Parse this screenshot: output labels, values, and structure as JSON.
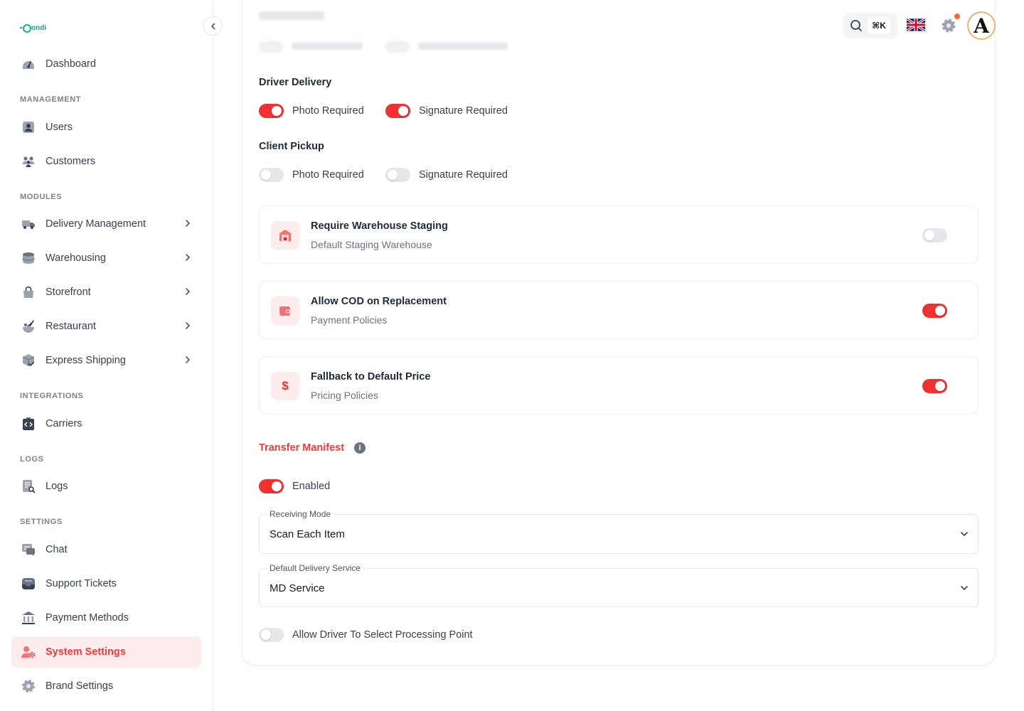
{
  "brand": {
    "name": "ondi"
  },
  "sidebar": {
    "dashboard": "Dashboard",
    "sections": {
      "management": "MANAGEMENT",
      "modules": "MODULES",
      "integrations": "INTEGRATIONS",
      "logs": "LOGS",
      "settings": "SETTINGS"
    },
    "items": {
      "users": "Users",
      "customers": "Customers",
      "delivery_management": "Delivery Management",
      "warehousing": "Warehousing",
      "storefront": "Storefront",
      "restaurant": "Restaurant",
      "express_shipping": "Express Shipping",
      "carriers": "Carriers",
      "logs": "Logs",
      "chat": "Chat",
      "support_tickets": "Support Tickets",
      "payment_methods": "Payment Methods",
      "system_settings": "System Settings",
      "brand_settings": "Brand Settings"
    },
    "active": "system_settings"
  },
  "topbar": {
    "search_shortcut": "⌘K",
    "language_icon": "uk-flag-icon",
    "settings_icon": "gear-icon",
    "has_notification": true
  },
  "settings": {
    "driver_delivery": {
      "title": "Driver Delivery",
      "photo_label": "Photo Required",
      "photo_on": true,
      "signature_label": "Signature Required",
      "signature_on": true
    },
    "client_pickup": {
      "title": "Client Pickup",
      "photo_label": "Photo Required",
      "photo_on": false,
      "signature_label": "Signature Required",
      "signature_on": false
    },
    "policies": [
      {
        "title": "Require Warehouse Staging",
        "subtitle": "Default Staging Warehouse",
        "icon": "warehouse-icon",
        "on": false
      },
      {
        "title": "Allow COD on Replacement",
        "subtitle": "Payment Policies",
        "icon": "wallet-icon",
        "on": true
      },
      {
        "title": "Fallback to Default Price",
        "subtitle": "Pricing Policies",
        "icon": "dollar-icon",
        "on": true
      }
    ],
    "transfer_manifest": {
      "title": "Transfer Manifest",
      "enabled_label": "Enabled",
      "enabled": true,
      "receiving_mode_label": "Receiving Mode",
      "receiving_mode_value": "Scan Each Item",
      "delivery_service_label": "Default Delivery Service",
      "delivery_service_value": "MD Service",
      "processing_point_label": "Allow Driver To Select Processing Point",
      "processing_point_on": false
    }
  },
  "colors": {
    "accent": "#ef3131",
    "active_bg": "#fdecec",
    "brand": "#10b2a0"
  }
}
